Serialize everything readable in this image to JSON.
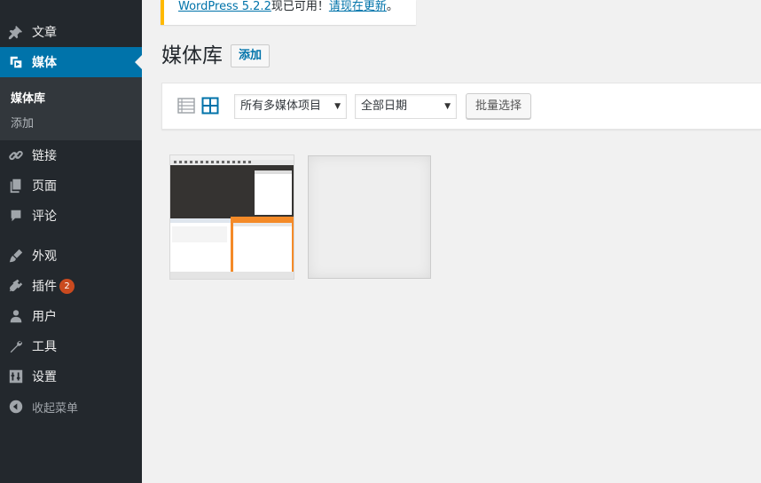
{
  "sidebar": {
    "items": [
      {
        "label": "文章",
        "icon": "pin-icon"
      },
      {
        "label": "媒体",
        "icon": "media-icon"
      },
      {
        "label": "链接",
        "icon": "link-icon"
      },
      {
        "label": "页面",
        "icon": "page-icon"
      },
      {
        "label": "评论",
        "icon": "comment-icon"
      },
      {
        "label": "外观",
        "icon": "brush-icon"
      },
      {
        "label": "插件",
        "icon": "plugin-icon",
        "badge": "2"
      },
      {
        "label": "用户",
        "icon": "user-icon"
      },
      {
        "label": "工具",
        "icon": "wrench-icon"
      },
      {
        "label": "设置",
        "icon": "settings-icon"
      },
      {
        "label": "收起菜单",
        "icon": "collapse-icon"
      }
    ],
    "submenu": [
      "媒体库",
      "添加"
    ]
  },
  "notice": {
    "link": "WordPress 5.2.2",
    "middle": "现已可用！",
    "update_link": "请现在更新",
    "end": "。"
  },
  "page": {
    "title": "媒体库",
    "add_new": "添加"
  },
  "toolbar": {
    "filter_type": "所有多媒体项目",
    "filter_date": "全部日期",
    "bulk_select": "批量选择"
  },
  "colors": {
    "sidebar_bg": "#23282d",
    "active_bg": "#0073aa",
    "notice_border": "#ffb900",
    "badge_bg": "#ca4a1f"
  }
}
